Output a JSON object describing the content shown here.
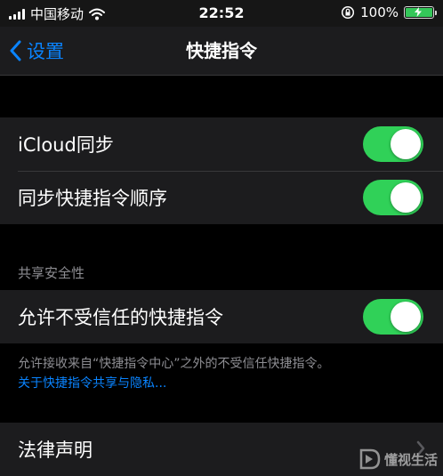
{
  "status_bar": {
    "carrier": "中国移动",
    "time": "22:52",
    "battery_percent": "100%",
    "battery_level": 1.0
  },
  "nav": {
    "back_label": "设置",
    "title": "快捷指令"
  },
  "sync_group": {
    "items": [
      {
        "label": "iCloud同步",
        "on": true
      },
      {
        "label": "同步快捷指令顺序",
        "on": true
      }
    ]
  },
  "security": {
    "header": "共享安全性",
    "items": [
      {
        "label": "允许不受信任的快捷指令",
        "on": true
      }
    ],
    "footer_text": "允许接收来自“快捷指令中心”之外的不受信任快捷指令。",
    "footer_link": "关于快捷指令共享与隐私..."
  },
  "legal": {
    "label": "法律声明"
  },
  "watermark": {
    "text": "懂视生活"
  },
  "colors": {
    "accent": "#0a84ff",
    "toggle_on": "#30d158",
    "background": "#000000",
    "cell": "#1c1c1e"
  }
}
